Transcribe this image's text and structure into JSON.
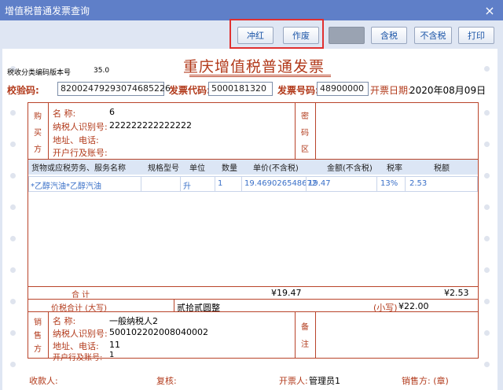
{
  "window": {
    "title": "增值税普通发票查询",
    "close_label": "×"
  },
  "toolbar": {
    "red_offset": "冲红",
    "void": "作废",
    "disabled_btn": "",
    "tax_incl": "含税",
    "tax_excl": "不含税",
    "print": "打印"
  },
  "invoice": {
    "version_label": "税收分类编码版本号",
    "version_value": "35.0",
    "title": "重庆增值税普通发票",
    "check_code_label": "校验码:",
    "check_code": "82002479293074685226",
    "code_label": "发票代码:",
    "code": "5000181320",
    "number_label": "发票号码:",
    "number": "48900000",
    "date_label": "开票日期:",
    "date": "2020年08月09日",
    "buyer": {
      "side_label": "购买方",
      "name_label": "名        称:",
      "name": "6",
      "taxid_label": "纳税人识别号:",
      "taxid": "222222222222222",
      "addr_label": "地址、电话:",
      "addr": "",
      "bank_label": "开户行及账号:",
      "bank": ""
    },
    "cipher_label": "密码区",
    "items_headers": [
      "货物或应税劳务、服务名称",
      "规格型号",
      "单位",
      "数量",
      "单价(不含税)",
      "金额(不含税)",
      "税率",
      "税额"
    ],
    "items": [
      {
        "name": "*乙醇汽油*乙醇汽油",
        "spec": "",
        "unit": "升",
        "qty": "1",
        "price": "19.469026548672",
        "amount": "19.47",
        "rate": "13%",
        "tax": "2.53"
      }
    ],
    "sum_label": "合        计",
    "sum_amount": "¥19.47",
    "sum_tax": "¥2.53",
    "total_label": "价税合计 (大写)",
    "total_upper": "贰拾贰圆整",
    "total_lower_label": "(小写)",
    "total_lower": "¥22.00",
    "seller": {
      "side_label": "销售方",
      "name_label": "名        称:",
      "name": "一般纳税人2",
      "taxid_label": "纳税人识别号:",
      "taxid": "500102202008040002",
      "addr_label": "地址、电话:",
      "addr": "11",
      "bank_label": "开户行及账号:",
      "bank": "1"
    },
    "remark_label": "备注",
    "footer": {
      "payee_label": "收款人:",
      "reviewer_label": "复核:",
      "drawer_label": "开票人:",
      "drawer": "管理员1",
      "seller_label": "销售方: (章)"
    }
  }
}
